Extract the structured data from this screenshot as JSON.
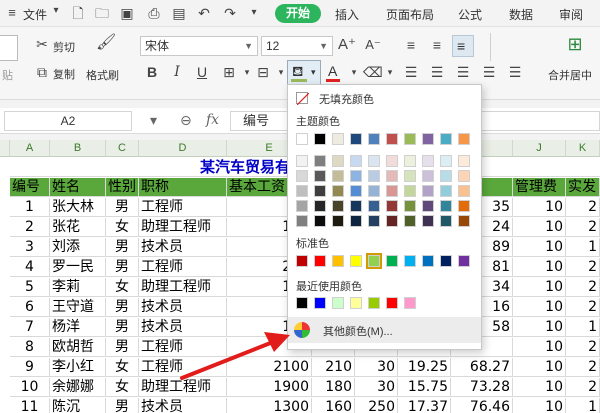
{
  "menubar": {
    "file": "文件",
    "tabs": [
      "开始",
      "插入",
      "页面布局",
      "公式",
      "数据",
      "审阅"
    ]
  },
  "toolbar": {
    "cut": "剪切",
    "paste": "贴",
    "copy": "复制",
    "format_painter": "格式刷",
    "font_name": "宋体",
    "font_size": "12",
    "merge_center": "合并居中"
  },
  "formula_bar": {
    "cell_ref": "A2",
    "fx": "fx",
    "value": "编号"
  },
  "sheet": {
    "columns": [
      "A",
      "B",
      "C",
      "D",
      "E",
      "F",
      "G",
      "H",
      "I",
      "J",
      "K"
    ],
    "title": "某汽车贸易有限公司员工工资表",
    "headers": [
      "编号",
      "姓名",
      "性别",
      "职称",
      "基本工资",
      "",
      "",
      "",
      "",
      "管理费",
      "实发"
    ],
    "rows": [
      [
        "1",
        "张大林",
        "男",
        "工程师",
        "21",
        "",
        "",
        "",
        "35",
        "10",
        "2"
      ],
      [
        "2",
        "张花",
        "女",
        "助理工程师",
        "180",
        "",
        "",
        "",
        "24",
        "10",
        "2"
      ],
      [
        "3",
        "刘添",
        "男",
        "技术员",
        "14",
        "",
        "",
        "",
        "89",
        "10",
        "1"
      ],
      [
        "4",
        "罗一民",
        "男",
        "工程师",
        "200",
        "",
        "",
        "",
        "81",
        "10",
        "2"
      ],
      [
        "5",
        "李莉",
        "女",
        "助理工程师",
        "170",
        "",
        "",
        "",
        "34",
        "10",
        "2"
      ],
      [
        "6",
        "王守道",
        "男",
        "技术员",
        "18",
        "",
        "",
        "",
        "16",
        "10",
        "2"
      ],
      [
        "7",
        "杨洋",
        "男",
        "技术员",
        "140",
        "",
        "",
        "",
        "58",
        "10",
        "1"
      ],
      [
        "8",
        "欧胡哲",
        "男",
        "工程师",
        "",
        "",
        "",
        "",
        "",
        "10",
        "2"
      ],
      [
        "9",
        "李小红",
        "女",
        "工程师",
        "2100",
        "210",
        "30",
        "19.25",
        "68.27",
        "10",
        "2"
      ],
      [
        "10",
        "余娜娜",
        "女",
        "助理工程师",
        "1900",
        "180",
        "30",
        "15.75",
        "73.28",
        "10",
        "2"
      ],
      [
        "11",
        "陈沉",
        "男",
        "技术员",
        "1300",
        "160",
        "250",
        "17.37",
        "76.46",
        "10",
        "1"
      ]
    ]
  },
  "color_menu": {
    "no_fill": "无填充颜色",
    "theme_label": "主题颜色",
    "standard_label": "标准色",
    "recent_label": "最近使用颜色",
    "more_colors": "其他颜色(M)...",
    "theme_top": [
      "#ffffff",
      "#000000",
      "#eeece1",
      "#1f497d",
      "#4f81bd",
      "#c0504d",
      "#9bbb59",
      "#8064a2",
      "#4bacc6",
      "#f79646"
    ],
    "theme_shades": [
      [
        "#f2f2f2",
        "#7f7f7f",
        "#ddd9c3",
        "#c6d9f0",
        "#dbe5f1",
        "#f2dcdb",
        "#ebf1dd",
        "#e5e0ec",
        "#dbeef3",
        "#fdeada"
      ],
      [
        "#d8d8d8",
        "#595959",
        "#c4bd97",
        "#8db3e2",
        "#b8cce4",
        "#e5b9b7",
        "#d7e3bc",
        "#ccc1d9",
        "#b7dde8",
        "#fbd5b5"
      ],
      [
        "#bfbfbf",
        "#3f3f3f",
        "#938953",
        "#548dd4",
        "#95b3d7",
        "#d99694",
        "#c3d69b",
        "#b2a2c7",
        "#92cddc",
        "#fac08f"
      ],
      [
        "#a5a5a5",
        "#262626",
        "#494429",
        "#17365d",
        "#366092",
        "#953734",
        "#76923c",
        "#5f497a",
        "#31859b",
        "#e36c09"
      ],
      [
        "#7f7f7f",
        "#0c0c0c",
        "#1d1b10",
        "#0f243e",
        "#244061",
        "#632423",
        "#4f6128",
        "#3f3151",
        "#205867",
        "#974806"
      ]
    ],
    "standard": [
      "#c00000",
      "#ff0000",
      "#ffc000",
      "#ffff00",
      "#92d050",
      "#00b050",
      "#00b0f0",
      "#0070c0",
      "#002060",
      "#7030a0"
    ],
    "recent": [
      "#000000",
      "#0000ff",
      "#ccffcc",
      "#ffff99",
      "#99cc00",
      "#ff0000",
      "#ff99cc"
    ]
  }
}
